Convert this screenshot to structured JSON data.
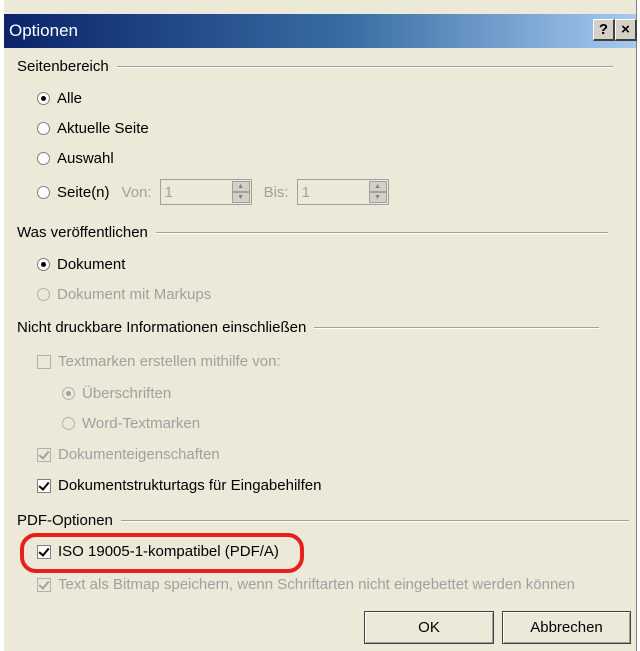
{
  "window": {
    "title": "Optionen",
    "help_label": "?",
    "close_label": "×"
  },
  "page_range": {
    "heading": "Seitenbereich",
    "options": [
      "Alle",
      "Aktuelle Seite",
      "Auswahl",
      "Seite(n)"
    ],
    "selected": "Alle",
    "from_label": "Von:",
    "from_value": "1",
    "to_label": "Bis:",
    "to_value": "1"
  },
  "publish": {
    "heading": "Was veröffentlichen",
    "options": [
      "Dokument",
      "Dokument mit Markups"
    ],
    "selected": "Dokument"
  },
  "non_printable": {
    "heading": "Nicht druckbare Informationen einschließen",
    "bookmarks_label": "Textmarken erstellen mithilfe von:",
    "bookmark_options": [
      "Überschriften",
      "Word-Textmarken"
    ],
    "bookmark_selected": "Überschriften",
    "doc_properties_label": "Dokumenteigenschaften",
    "structure_tags_label": "Dokumentstrukturtags für Eingabehilfen"
  },
  "pdf_options": {
    "heading": "PDF-Optionen",
    "iso_label": "ISO 19005-1-kompatibel (PDF/A)",
    "bitmap_label": "Text als Bitmap speichern, wenn Schriftarten nicht eingebettet werden können"
  },
  "buttons": {
    "ok": "OK",
    "cancel": "Abbrechen"
  },
  "colors": {
    "highlight": "#e8201c",
    "title_start": "#0a246a",
    "title_end": "#a6caf0"
  }
}
